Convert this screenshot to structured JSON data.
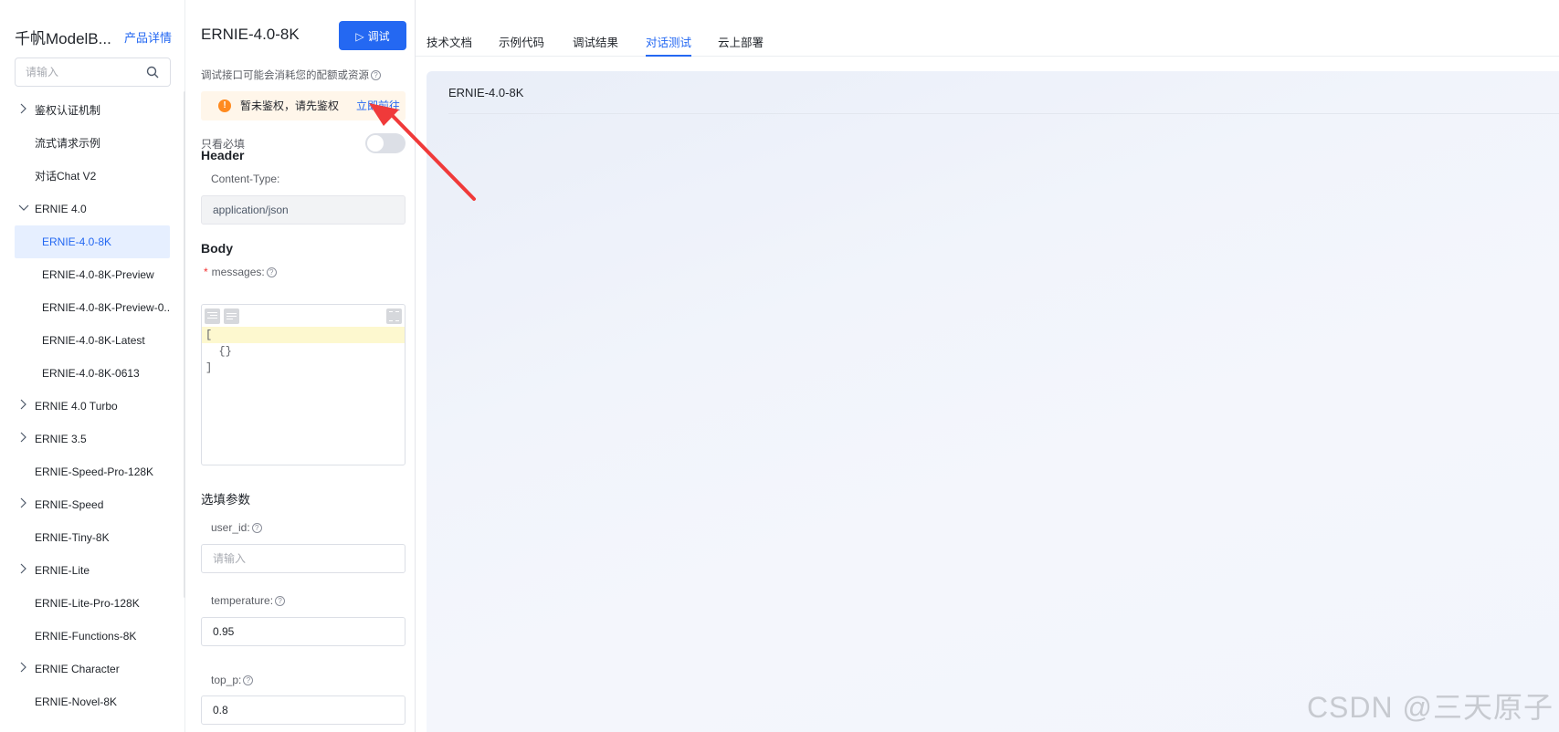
{
  "sidebar": {
    "title": "千帆ModelB...",
    "detail_link": "产品详情",
    "search_placeholder": "请输入",
    "items": [
      {
        "label": "鉴权认证机制",
        "chevron": "right"
      },
      {
        "label": "流式请求示例",
        "chevron": ""
      },
      {
        "label": "对话Chat V2",
        "chevron": ""
      },
      {
        "label": "ERNIE 4.0",
        "chevron": "down"
      },
      {
        "label": "ERNIE-4.0-8K",
        "chevron": "",
        "child": true,
        "active": true
      },
      {
        "label": "ERNIE-4.0-8K-Preview",
        "chevron": "",
        "child": true
      },
      {
        "label": "ERNIE-4.0-8K-Preview-0...",
        "chevron": "",
        "child": true
      },
      {
        "label": "ERNIE-4.0-8K-Latest",
        "chevron": "",
        "child": true
      },
      {
        "label": "ERNIE-4.0-8K-0613",
        "chevron": "",
        "child": true
      },
      {
        "label": "ERNIE 4.0 Turbo",
        "chevron": "right"
      },
      {
        "label": "ERNIE 3.5",
        "chevron": "right"
      },
      {
        "label": "ERNIE-Speed-Pro-128K",
        "chevron": ""
      },
      {
        "label": "ERNIE-Speed",
        "chevron": "right"
      },
      {
        "label": "ERNIE-Tiny-8K",
        "chevron": ""
      },
      {
        "label": "ERNIE-Lite",
        "chevron": "right"
      },
      {
        "label": "ERNIE-Lite-Pro-128K",
        "chevron": ""
      },
      {
        "label": "ERNIE-Functions-8K",
        "chevron": ""
      },
      {
        "label": "ERNIE Character",
        "chevron": "right"
      },
      {
        "label": "ERNIE-Novel-8K",
        "chevron": ""
      }
    ]
  },
  "debug_panel": {
    "title": "ERNIE-4.0-8K",
    "debug_button": "调试",
    "notice": "调试接口可能会消耗您的配额或资源",
    "auth_warning": "暂未鉴权，请先鉴权",
    "auth_link": "立即前往",
    "required_only_label": "只看必填",
    "required_only_on": false,
    "header_section": "Header",
    "content_type_label": "Content-Type:",
    "content_type_value": "application/json",
    "body_section": "Body",
    "messages_label": "messages:",
    "editor_lines": [
      "[",
      "  {}",
      "]"
    ],
    "optional_section": "选填参数",
    "user_id_label": "user_id:",
    "user_id_placeholder": "请输入",
    "temperature_label": "temperature:",
    "temperature_value": "0.95",
    "top_p_label": "top_p:",
    "top_p_value": "0.8"
  },
  "tabs": [
    {
      "label": "技术文档",
      "active": false
    },
    {
      "label": "示例代码",
      "active": false
    },
    {
      "label": "调试结果",
      "active": false
    },
    {
      "label": "对话测试",
      "active": true
    },
    {
      "label": "云上部署",
      "active": false
    }
  ],
  "chat": {
    "model_name": "ERNIE-4.0-8K"
  },
  "watermark": "CSDN @三天原子",
  "colors": {
    "accent": "#2468f2",
    "warning": "#ff8a1f",
    "annotation_arrow": "#f03a3a"
  }
}
